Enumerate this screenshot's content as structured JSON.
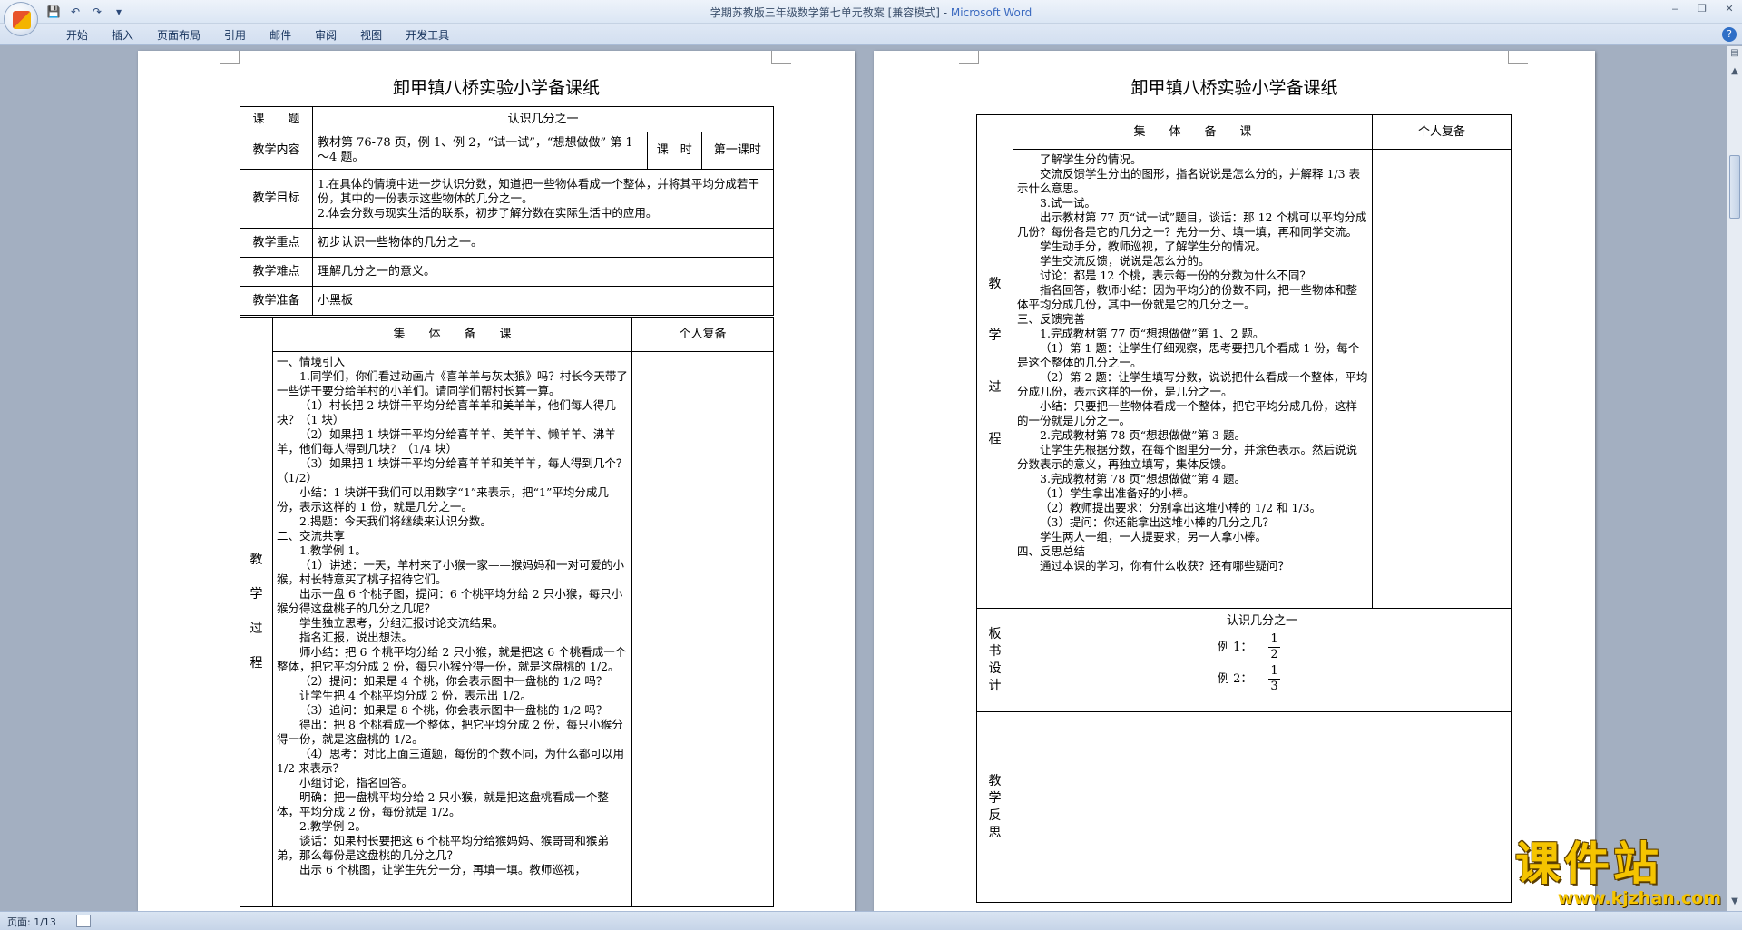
{
  "window": {
    "doc_title": "学期苏教版三年级数学第七单元教案 [兼容模式] - ",
    "app_name": "Microsoft Word",
    "controls": [
      "‒",
      "❐",
      "✕"
    ]
  },
  "qat": {
    "save": "💾",
    "undo": "↶",
    "redo": "↷",
    "more": "▾"
  },
  "ribbon_tabs": [
    "开始",
    "插入",
    "页面布局",
    "引用",
    "邮件",
    "审阅",
    "视图",
    "开发工具"
  ],
  "page1": {
    "title": "卸甲镇八桥实验小学备课纸",
    "rows": {
      "topic_label": "课　　题",
      "topic_value": "认识几分之一",
      "content_label": "教学内容",
      "content_value": "教材第 76-78 页，例 1、例 2，“试一试”，“想想做做” 第 1～4 题。",
      "hours_label": "课　时",
      "hours_value": "第一课时",
      "goal_label": "教学目标",
      "goal_1": "1.在具体的情境中进一步认识分数，知道把一些物体看成一个整体，并将其平均分成若干份，其中的一份表示这些物体的几分之一。",
      "goal_2": "2.体会分数与现实生活的联系，初步了解分数在实际生活中的应用。",
      "key_label": "教学重点",
      "key_value": "初步认识一些物体的几分之一。",
      "diff_label": "教学难点",
      "diff_value": "理解几分之一的意义。",
      "prep_label": "教学准备",
      "prep_value": "小黑板",
      "group_header": "集　　体　　备　　课",
      "personal_header": "个人复备",
      "process_label": "教\n\n学\n\n过\n\n程"
    },
    "process": [
      "一、情境引入",
      "1.同学们，你们看过动画片《喜羊羊与灰太狼》吗？村长今天带了一些饼干要分给羊村的小羊们。请同学们帮村长算一算。",
      "（1）村长把 2 块饼干平均分给喜羊羊和美羊羊，他们每人得几块？（1 块）",
      "（2）如果把 1 块饼干平均分给喜羊羊、美羊羊、懒羊羊、沸羊羊，他们每人得到几块？（1/4 块）",
      "（3）如果把 1 块饼干平均分给喜羊羊和美羊羊，每人得到几个？（1/2）",
      "小结：1 块饼干我们可以用数字“1”来表示，把“1”平均分成几份，表示这样的 1 份，就是几分之一。",
      "2.揭题：今天我们将继续来认识分数。",
      "二、交流共享",
      "1.教学例 1。",
      "（1）讲述：一天，羊村来了小猴一家——猴妈妈和一对可爱的小猴，村长特意买了桃子招待它们。",
      "出示一盘 6 个桃子图，提问：6 个桃平均分给 2 只小猴，每只小猴分得这盘桃子的几分之几呢？",
      "学生独立思考，分组汇报讨论交流结果。",
      "指名汇报，说出想法。",
      "师小结：把 6 个桃平均分给 2 只小猴，就是把这 6 个桃看成一个整体，把它平均分成 2 份，每只小猴分得一份，就是这盘桃的 1/2。",
      "（2）提问：如果是 4 个桃，你会表示图中一盘桃的 1/2 吗？",
      "让学生把 4 个桃平均分成 2 份，表示出 1/2。",
      "（3）追问：如果是 8 个桃，你会表示图中一盘桃的 1/2 吗？",
      "得出：把 8 个桃看成一个整体，把它平均分成 2 份，每只小猴分得一份，就是这盘桃的 1/2。",
      "（4）思考：对比上面三道题，每份的个数不同，为什么都可以用 1/2 来表示？",
      "小组讨论，指名回答。",
      "明确：把一盘桃平均分给 2 只小猴，就是把这盘桃看成一个整体，平均分成 2 份，每份就是 1/2。",
      "2.教学例 2。",
      "谈话：如果村长要把这 6 个桃平均分给猴妈妈、猴哥哥和猴弟弟，那么每份是这盘桃的几分之几？",
      "出示 6 个桃图，让学生先分一分，再填一填。教师巡视，"
    ]
  },
  "page2": {
    "title": "卸甲镇八桥实验小学备课纸",
    "group_header": "集　　体　　备　　课",
    "personal_header": "个人复备",
    "process_label": "教\n\n\n学\n\n\n过\n\n\n程",
    "process": [
      "了解学生分的情况。",
      "交流反馈学生分出的图形，指名说说是怎么分的，并解释 1/3 表示什么意思。",
      "3.试一试。",
      "出示教材第 77 页“试一试”题目，谈话：那 12 个桃可以平均分成几份？每份各是它的几分之一？先分一分、填一填，再和同学交流。",
      "学生动手分，教师巡视，了解学生分的情况。",
      "学生交流反馈，说说是怎么分的。",
      "讨论：都是 12 个桃，表示每一份的分数为什么不同？",
      "指名回答，教师小结：因为平均分的份数不同，把一些物体和整体平均分成几份，其中一份就是它的几分之一。",
      "三、反馈完善",
      "1.完成教材第 77 页“想想做做”第 1、2 题。",
      "（1）第 1 题：让学生仔细观察，思考要把几个看成 1 份，每个是这个整体的几分之一。",
      "（2）第 2 题：让学生填写分数，说说把什么看成一个整体，平均分成几份，表示这样的一份，是几分之一。",
      "小结：只要把一些物体看成一个整体，把它平均分成几份，这样的一份就是几分之一。",
      "2.完成教材第 78 页“想想做做”第 3 题。",
      "让学生先根据分数，在每个图里分一分，并涂色表示。然后说说分数表示的意义，再独立填写，集体反馈。",
      "3.完成教材第 78 页“想想做做”第 4 题。",
      "（1）学生拿出准备好的小棒。",
      "（2）教师提出要求：分别拿出这堆小棒的 1/2 和 1/3。",
      "（3）提问：你还能拿出这堆小棒的几分之几？",
      "学生两人一组，一人提要求，另一人拿小棒。",
      "四、反思总结",
      "通过本课的学习，你有什么收获？还有哪些疑问？"
    ],
    "board_label": "板\n书\n设\n计",
    "board_title": "认识几分之一",
    "board_ex1": "例 1：",
    "board_ex1_num": "1",
    "board_ex1_den": "2",
    "board_ex2": "例 2：",
    "board_ex2_num": "1",
    "board_ex2_den": "3",
    "reflect_label": "教\n学\n反\n思"
  },
  "status": {
    "page": "页面: 1/13"
  },
  "watermark": {
    "big": "课件站",
    "url": "www.kjzhan.com"
  }
}
